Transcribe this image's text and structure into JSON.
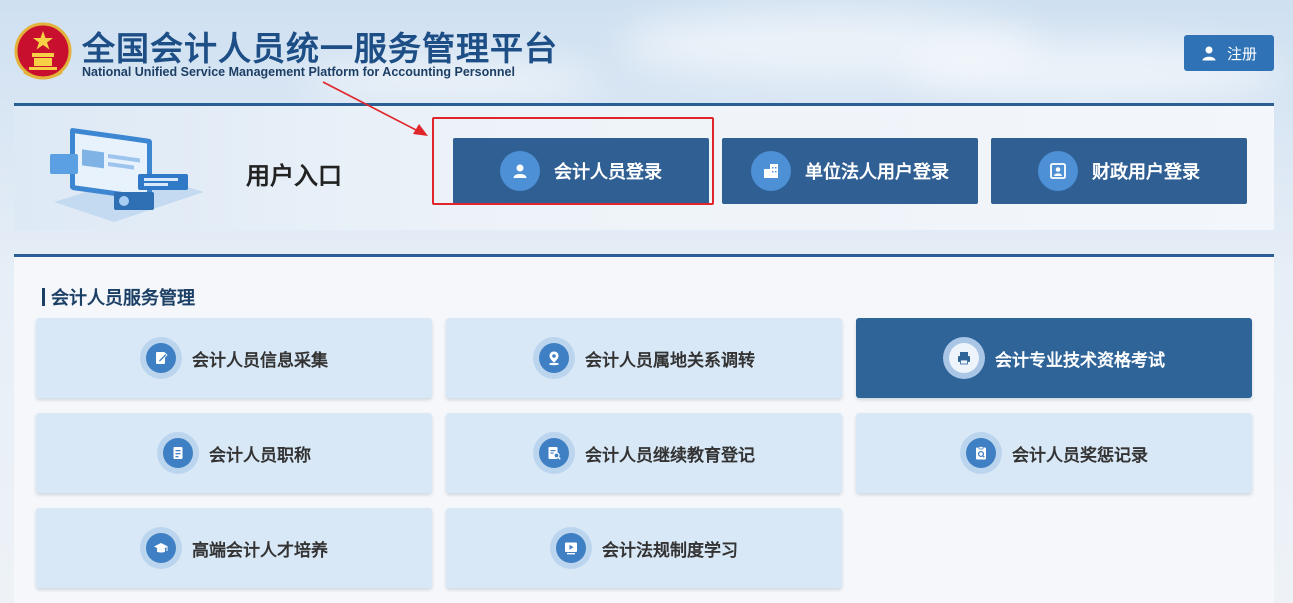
{
  "header": {
    "title": "全国会计人员统一服务管理平台",
    "subtitle": "National Unified Service Management Platform for Accounting Personnel",
    "register_label": "注册"
  },
  "entry": {
    "title": "用户入口",
    "buttons": [
      {
        "label": "会计人员登录",
        "icon": "person-icon"
      },
      {
        "label": "单位法人用户登录",
        "icon": "building-icon"
      },
      {
        "label": "财政用户登录",
        "icon": "id-card-icon"
      }
    ]
  },
  "services": {
    "title": "会计人员服务管理",
    "items": [
      {
        "label": "会计人员信息采集",
        "icon": "edit-document-icon"
      },
      {
        "label": "会计人员属地关系调转",
        "icon": "map-pin-icon"
      },
      {
        "label": "会计专业技术资格考试",
        "icon": "printer-icon"
      },
      {
        "label": "会计人员职称",
        "icon": "document-icon"
      },
      {
        "label": "会计人员继续教育登记",
        "icon": "document-search-icon"
      },
      {
        "label": "会计人员奖惩记录",
        "icon": "clipboard-search-icon"
      },
      {
        "label": "高端会计人才培养",
        "icon": "graduation-cap-icon"
      },
      {
        "label": "会计法规制度学习",
        "icon": "play-video-icon"
      }
    ]
  },
  "colors": {
    "primary": "#2f5f93",
    "accent": "#2f73b6",
    "highlight": "#e0262a",
    "tile": "#d9e8f7"
  }
}
